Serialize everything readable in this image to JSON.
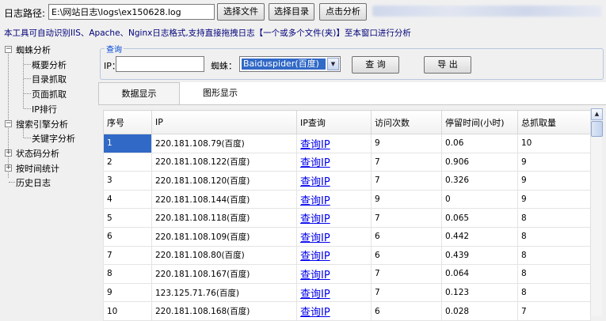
{
  "toolbar": {
    "path_label": "日志路径:",
    "path_value": "E:\\网站日志\\logs\\ex150628.log",
    "select_file": "选择文件",
    "select_dir": "选择目录",
    "analyze": "点击分析"
  },
  "info_text": "本工具可自动识别IIS、Apache、Nginx日志格式,支持直接拖拽日志【一个或多个文件(夹)】至本窗口进行分析",
  "tree": {
    "group1": "蜘蛛分析",
    "group1_children": [
      "概要分析",
      "目录抓取",
      "页面抓取",
      "IP排行"
    ],
    "group2": "搜索引擎分析",
    "group2_children": [
      "关键字分析"
    ],
    "group3": "状态码分析",
    "group4": "按时间统计",
    "group5": "历史日志",
    "toggle_expanded": "−",
    "toggle_collapsed": "+"
  },
  "query": {
    "legend": "查询",
    "ip_label": "IP：",
    "ip_value": "",
    "spider_label": "蜘蛛：",
    "spider_value": "Baiduspider(百度)",
    "query_button": "查 询",
    "export_button": "导 出"
  },
  "tabs": [
    "数据显示",
    "图形显示"
  ],
  "table": {
    "columns": [
      "序号",
      "IP",
      "IP查询",
      "访问次数",
      "停留时间(小时)",
      "总抓取量"
    ],
    "link_text": "查询IP",
    "rows": [
      [
        "1",
        "220.181.108.79(百度)",
        "9",
        "0.06",
        "10"
      ],
      [
        "2",
        "220.181.108.122(百度)",
        "7",
        "0.906",
        "9"
      ],
      [
        "3",
        "220.181.108.120(百度)",
        "7",
        "0.326",
        "9"
      ],
      [
        "4",
        "220.181.108.144(百度)",
        "9",
        "0",
        "9"
      ],
      [
        "5",
        "220.181.108.118(百度)",
        "7",
        "0.065",
        "8"
      ],
      [
        "6",
        "220.181.108.109(百度)",
        "6",
        "0.442",
        "8"
      ],
      [
        "7",
        "220.181.108.80(百度)",
        "6",
        "0.439",
        "8"
      ],
      [
        "8",
        "220.181.108.167(百度)",
        "7",
        "0.064",
        "8"
      ],
      [
        "9",
        "123.125.71.76(百度)",
        "7",
        "0.123",
        "8"
      ],
      [
        "10",
        "220.181.108.168(百度)",
        "6",
        "0.028",
        "7"
      ]
    ]
  },
  "icons": {
    "dropdown": "▼",
    "scroll_up": "▲"
  }
}
